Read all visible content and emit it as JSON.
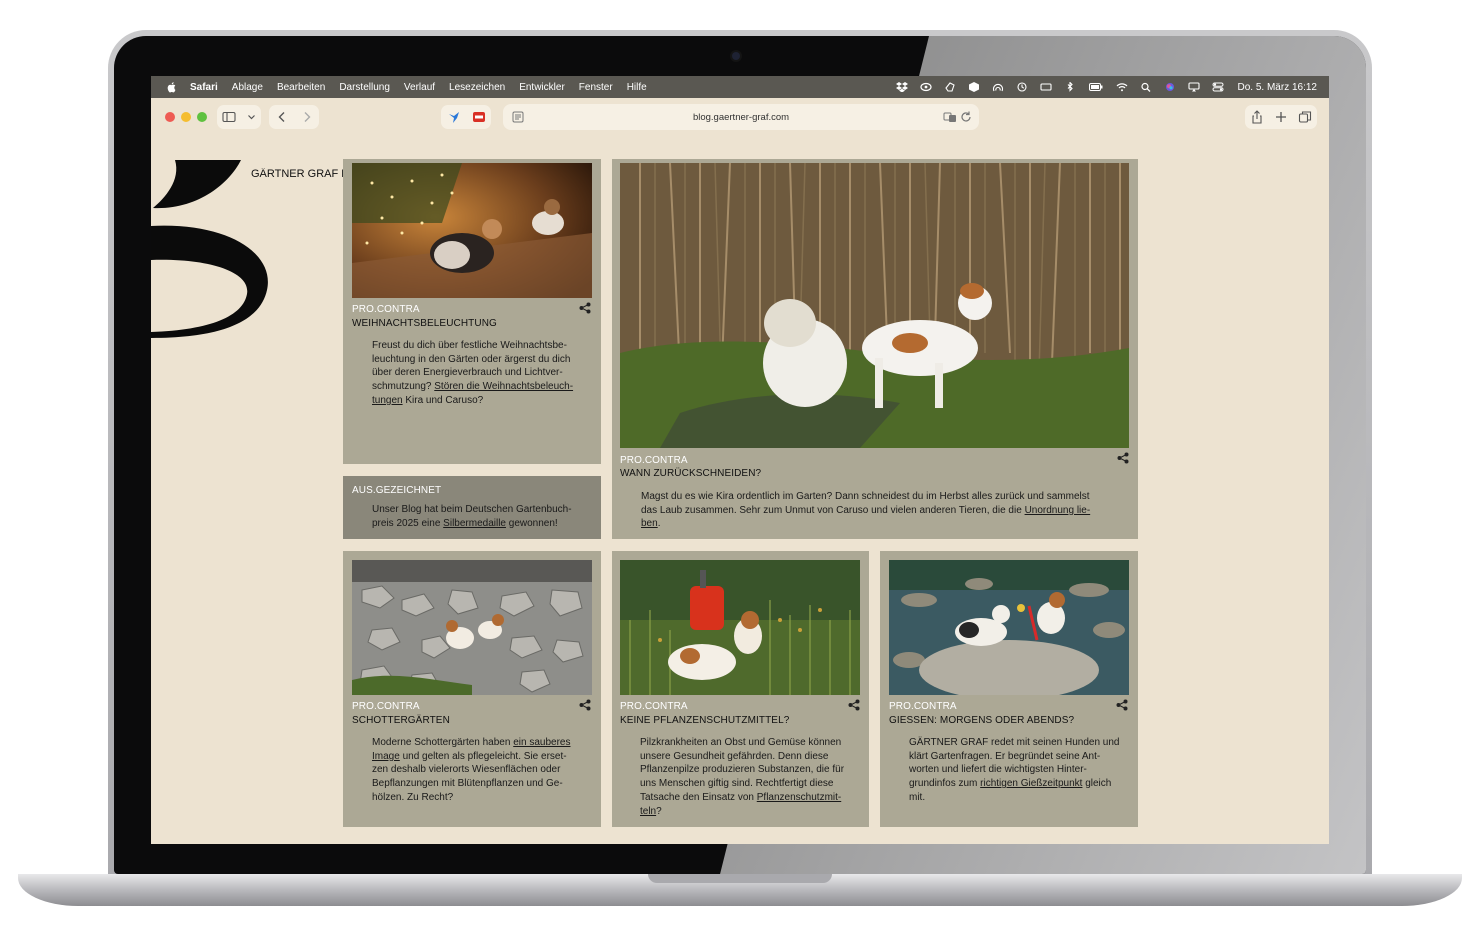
{
  "menubar": {
    "app": "Safari",
    "items": [
      "Ablage",
      "Bearbeiten",
      "Darstellung",
      "Verlauf",
      "Lesezeichen",
      "Entwickler",
      "Fenster",
      "Hilfe"
    ],
    "clock": "Do. 5. März  16:12"
  },
  "toolbar": {
    "url": "blog.gaertner-graf.com"
  },
  "site": {
    "name": "GÄRTNER GRAF BLOG"
  },
  "posts": {
    "weihnacht": {
      "category": "PRO.CONTRA",
      "title": "WEIHNACHTSBELEUCHTUNG",
      "line1": "Freust du dich über festliche Weihnachtsbe-",
      "line2": "leuchtung in den Gärten oder ärgerst du dich",
      "line3": "über deren Energieverbrauch und Lichtver-",
      "line4a": "schmutzung? ",
      "line4link": "Stören die Weihnachtsbeleuch-",
      "line5link": "tungen",
      "line5b": " Kira und Caruso?"
    },
    "award": {
      "category": "AUS.GEZEICHNET",
      "line1": "Unser Blog hat beim Deutschen Gartenbuch-",
      "line2a": "preis 2025 eine ",
      "line2link": "Silbermedaille",
      "line2b": " gewonnen!"
    },
    "zurueck": {
      "category": "PRO.CONTRA",
      "title": "WANN ZURÜCKSCHNEIDEN?",
      "line1": "Magst du es wie Kira ordentlich im Garten? Dann schneidest du im Herbst alles zurück und sammelst",
      "line2a": "das Laub zusammen. Sehr zum Unmut von Caruso und vielen anderen Tieren, die die ",
      "line2link": "Unordnung lie-",
      "line3link": "ben",
      "line3b": "."
    },
    "schotter": {
      "category": "PRO.CONTRA",
      "title": "SCHOTTERGÄRTEN",
      "line1a": "Moderne Schottergärten haben ",
      "line1link": "ein sauberes",
      "line2link": "Image",
      "line2b": " und gelten als pflegeleicht. Sie erset-",
      "line3": "zen deshalb vielerorts Wiesenflächen oder",
      "line4": "Bepflanzungen mit Blütenpflanzen und Ge-",
      "line5": "hölzen. Zu Recht?"
    },
    "pflanzenschutz": {
      "category": "PRO.CONTRA",
      "title": "KEINE PFLANZENSCHUTZMITTEL?",
      "line1": "Pilzkrankheiten an Obst und Gemüse können",
      "line2": "unsere Gesundheit gefährden. Denn diese",
      "line3": "Pflanzenpilze produzieren Substanzen, die für",
      "line4": "uns Menschen giftig sind. Rechtfertigt diese",
      "line5a": "Tatsache den Einsatz von ",
      "line5link": "Pflanzenschutzmit-",
      "line6link": "teln",
      "line6b": "?"
    },
    "giessen": {
      "category": "PRO.CONTRA",
      "title": "GIESSEN: MORGENS ODER ABENDS?",
      "line1": "GÄRTNER GRAF redet mit seinen Hunden und",
      "line2": "klärt Gartenfragen. Er begründet seine Ant-",
      "line3": "worten und liefert die wichtigsten Hinter-",
      "line4a": "grundinfos zum ",
      "line4link": "richtigen Gießzeitpunkt",
      "line4b": " gleich",
      "line5": "mit."
    }
  },
  "icons": {
    "apple": "apple-icon",
    "share": "share-icon",
    "sidebar": "sidebar-toggle-icon",
    "back": "back-arrow-icon",
    "forward": "forward-arrow-icon",
    "share_toolbar": "share-toolbar-icon",
    "new_tab": "plus-icon",
    "tabs": "tab-overview-icon"
  },
  "colors": {
    "page_bg": "#ede3d1",
    "card_bg": "#aca895",
    "card_dark_bg": "#8a877a",
    "menubar_bg": "#5a5852",
    "category_text": "#ffffff"
  }
}
